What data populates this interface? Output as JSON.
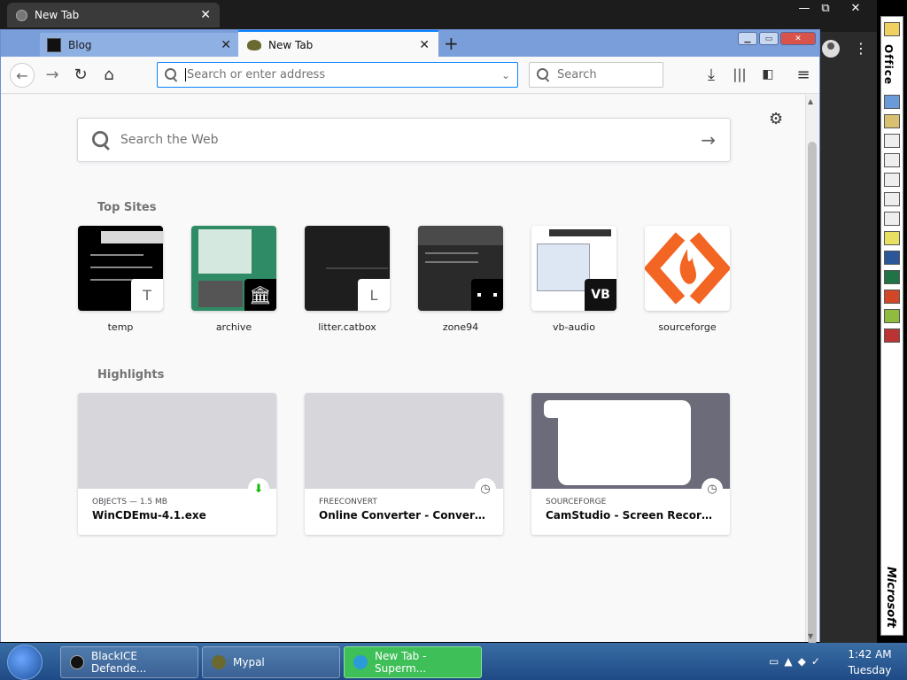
{
  "chrome": {
    "tab_title": "New Tab",
    "min": "—",
    "max": "⧉",
    "close": "✕",
    "menu_dots": "⋮"
  },
  "firefox": {
    "tabs": [
      {
        "label": "Blog",
        "favicon": "blog-favicon"
      },
      {
        "label": "New Tab",
        "favicon": "new-tab-favicon"
      }
    ],
    "url_placeholder": "Search or enter address",
    "search_placeholder": "Search",
    "web_search_placeholder": "Search the Web",
    "top_sites_title": "Top Sites",
    "top_sites": [
      {
        "label": "temp",
        "badge": "T"
      },
      {
        "label": "archive",
        "badge": ""
      },
      {
        "label": "litter.catbox",
        "badge": "L"
      },
      {
        "label": "zone94",
        "badge": ""
      },
      {
        "label": "vb-audio",
        "badge": ""
      },
      {
        "label": "sourceforge",
        "badge": ""
      }
    ],
    "highlights_title": "Highlights",
    "highlights": [
      {
        "meta": "OBJECTS — 1.5 MB",
        "title": "WinCDEmu-4.1.exe",
        "icon": "download-icon"
      },
      {
        "meta": "FREECONVERT",
        "title": "Online Converter - Convert Ima...",
        "icon": "clock-icon"
      },
      {
        "meta": "SOURCEFORGE",
        "title": "CamStudio - Screen Recorder d...",
        "icon": "clock-icon"
      }
    ]
  },
  "taskbar": {
    "items": [
      {
        "label": "BlackICE Defende..."
      },
      {
        "label": "Mypal"
      },
      {
        "label": "New Tab - Superm..."
      }
    ],
    "time": "1:42 AM",
    "day": "Tuesday"
  },
  "office": {
    "label": "Office",
    "brand": "Microsoft"
  },
  "colors": {
    "accent": "#0a84ff",
    "taskbar": "#2b5c97",
    "active_task": "#3fbf58"
  }
}
